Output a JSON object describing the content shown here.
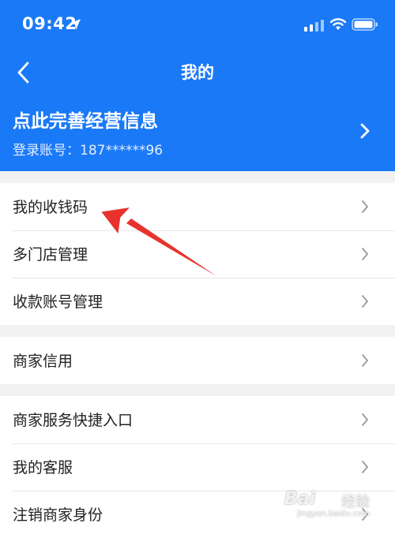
{
  "status_bar": {
    "time": "09:42",
    "icons": [
      "location-arrow-icon",
      "signal-icon",
      "wifi-icon",
      "battery-icon"
    ]
  },
  "nav": {
    "back_icon": "back-chevron-icon",
    "title": "我的"
  },
  "profile": {
    "title": "点此完善经营信息",
    "account_label": "登录账号：",
    "account_value": "187******96"
  },
  "menu_groups": [
    {
      "items": [
        {
          "label": "我的收钱码"
        },
        {
          "label": "多门店管理"
        },
        {
          "label": "收款账号管理"
        }
      ]
    },
    {
      "items": [
        {
          "label": "商家信用"
        }
      ]
    },
    {
      "items": [
        {
          "label": "商家服务快捷入口"
        },
        {
          "label": "我的客服"
        },
        {
          "label": "注销商家身份"
        }
      ]
    }
  ],
  "watermark": {
    "logo_text": "Bai",
    "sub_text": "经验",
    "url": "jingyan.baidu.com"
  },
  "colors": {
    "header_bg": "#1a79f7",
    "page_bg": "#f2f2f2",
    "annotation_arrow": "#e8322d"
  }
}
